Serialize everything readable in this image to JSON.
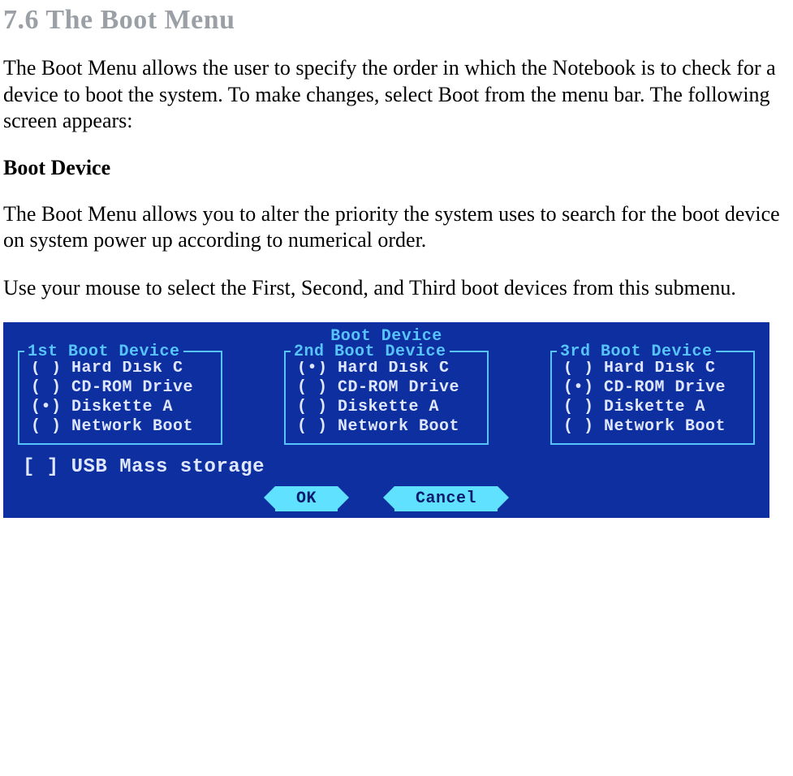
{
  "doc": {
    "section_title": "7.6   The Boot Menu",
    "para1": "The Boot Menu allows the user to specify the order in which the Notebook is to check for a device to boot the system. To make changes, select Boot from the menu bar. The following screen appears:",
    "subhead": "Boot Device",
    "para2": "The Boot Menu allows you to alter the priority the system uses to search for the boot device on system power up according to numerical order.",
    "para3": "Use your mouse to select the First, Second, and Third boot devices from this submenu."
  },
  "bios": {
    "window_title": "Boot Device",
    "groups": [
      {
        "legend": "1st Boot Device",
        "options": [
          {
            "label": "Hard Disk C",
            "selected": false
          },
          {
            "label": "CD-ROM Drive",
            "selected": false
          },
          {
            "label": "Diskette A",
            "selected": true
          },
          {
            "label": "Network Boot",
            "selected": false
          }
        ]
      },
      {
        "legend": "2nd Boot Device",
        "options": [
          {
            "label": "Hard Disk C",
            "selected": true
          },
          {
            "label": "CD-ROM Drive",
            "selected": false
          },
          {
            "label": "Diskette A",
            "selected": false
          },
          {
            "label": "Network Boot",
            "selected": false
          }
        ]
      },
      {
        "legend": "3rd Boot Device",
        "options": [
          {
            "label": "Hard Disk C",
            "selected": false
          },
          {
            "label": "CD-ROM Drive",
            "selected": true
          },
          {
            "label": "Diskette A",
            "selected": false
          },
          {
            "label": "Network Boot",
            "selected": false
          }
        ]
      }
    ],
    "usb_checkbox": {
      "label": "USB Mass storage",
      "checked": false
    },
    "buttons": {
      "ok": "OK",
      "cancel": "Cancel"
    }
  }
}
